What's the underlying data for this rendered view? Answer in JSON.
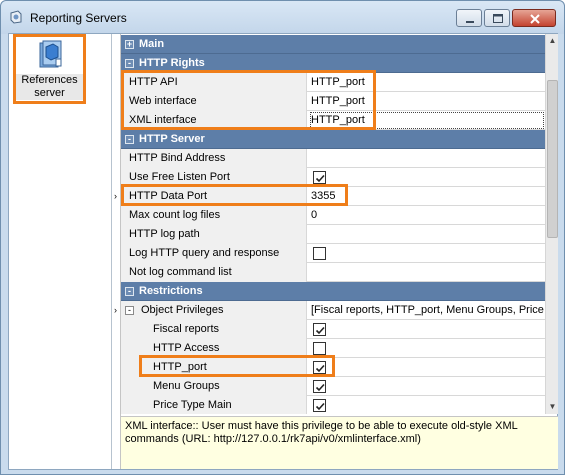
{
  "window": {
    "title": "Reporting Servers",
    "accent": "#ef7e1a"
  },
  "left": {
    "ref_label": "References server"
  },
  "grid": {
    "rows": [
      {
        "kind": "category",
        "label": "Main",
        "expander": "+"
      },
      {
        "kind": "category",
        "label": "HTTP Rights",
        "expander": "-"
      },
      {
        "kind": "text",
        "label": "HTTP API",
        "value": "HTTP_port"
      },
      {
        "kind": "text",
        "label": "Web interface",
        "value": "HTTP_port"
      },
      {
        "kind": "text",
        "label": "XML interface",
        "value": "HTTP_port",
        "focused": true
      },
      {
        "kind": "category",
        "label": "HTTP Server",
        "expander": "-"
      },
      {
        "kind": "text",
        "label": "HTTP Bind Address",
        "value": ""
      },
      {
        "kind": "check",
        "label": "Use Free Listen Port",
        "checked": true
      },
      {
        "kind": "text",
        "label": "HTTP Data Port",
        "value": "3355",
        "current": true
      },
      {
        "kind": "text",
        "label": "Max count log files",
        "value": "0"
      },
      {
        "kind": "text",
        "label": "HTTP log path",
        "value": ""
      },
      {
        "kind": "check",
        "label": "Log HTTP query and response",
        "checked": false
      },
      {
        "kind": "text",
        "label": "Not log command list",
        "value": ""
      },
      {
        "kind": "category",
        "label": "Restrictions",
        "expander": "-"
      },
      {
        "kind": "text",
        "label": "Object Privileges",
        "value": "[Fiscal reports, HTTP_port, Menu Groups, Price",
        "expander": "-"
      },
      {
        "kind": "check",
        "label": "Fiscal reports",
        "checked": true,
        "indent": 2
      },
      {
        "kind": "check",
        "label": "HTTP Access",
        "checked": false,
        "indent": 2
      },
      {
        "kind": "check",
        "label": "HTTP_port",
        "checked": true,
        "indent": 2
      },
      {
        "kind": "check",
        "label": "Menu Groups",
        "checked": true,
        "indent": 2
      },
      {
        "kind": "check",
        "label": "Price Type Main",
        "checked": true,
        "indent": 2
      }
    ]
  },
  "description": {
    "text": "XML interface:: User must have this privilege to be able to execute old-style XML commands (URL: http://127.0.0.1/rk7api/v0/xmlinterface.xml)"
  }
}
